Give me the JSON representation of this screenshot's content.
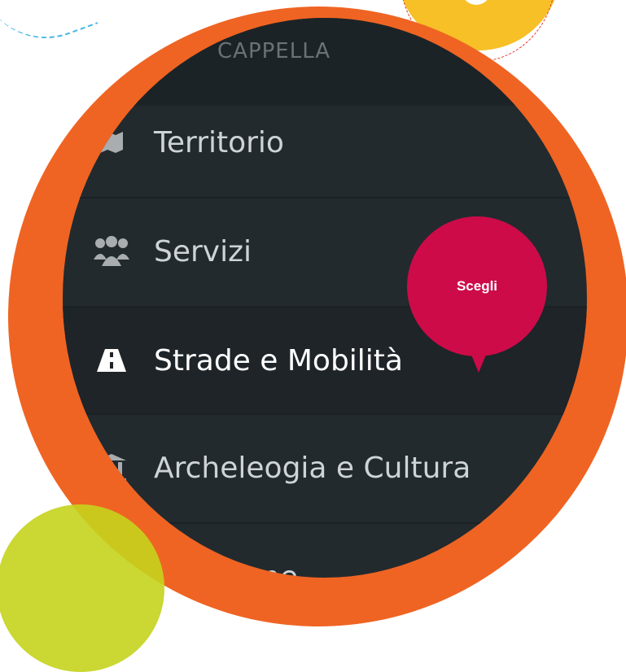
{
  "menu": {
    "top_label": "CAPPELLA",
    "items": [
      {
        "label": "Territorio",
        "icon": "map-icon"
      },
      {
        "label": "Servizi",
        "icon": "users-icon"
      },
      {
        "label": "Strade e Mobilità",
        "icon": "road-icon"
      },
      {
        "label": "Archeleogia e Cultura",
        "icon": "museum-icon"
      },
      {
        "label": "Istruzione",
        "icon": "education-icon"
      }
    ]
  },
  "tooltip": {
    "label": "Scegli"
  },
  "colors": {
    "orange_ring": "#ef6423",
    "yellow": "#f6c026",
    "lime": "#c5d31c",
    "tooltip": "#cd0b49",
    "menu_bg": "#222a2e"
  }
}
